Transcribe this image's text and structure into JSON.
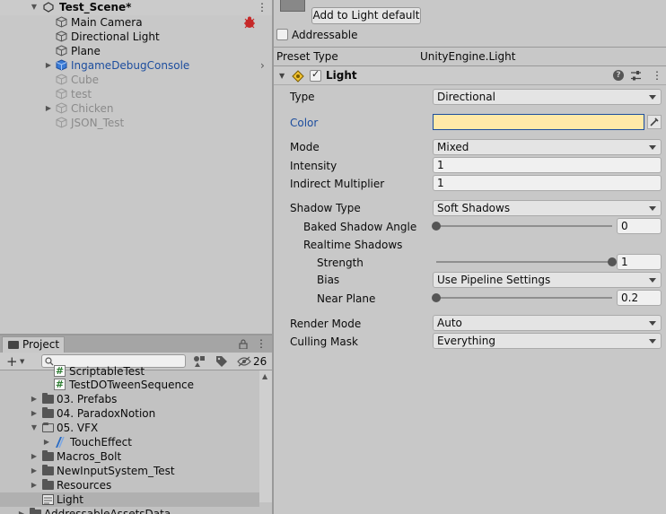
{
  "hierarchy": {
    "scene_name": "Test_Scene*",
    "items": [
      {
        "label": "Main Camera",
        "state": "normal"
      },
      {
        "label": "Directional Light",
        "state": "normal"
      },
      {
        "label": "Plane",
        "state": "normal"
      },
      {
        "label": "IngameDebugConsole",
        "state": "prefab"
      },
      {
        "label": "Cube",
        "state": "disabled"
      },
      {
        "label": "test",
        "state": "disabled"
      },
      {
        "label": "Chicken",
        "state": "disabled"
      },
      {
        "label": "JSON_Test",
        "state": "disabled"
      }
    ]
  },
  "project": {
    "tab_label": "Project",
    "hidden_count": "26",
    "items": [
      {
        "label": "ScriptableTest",
        "kind": "script"
      },
      {
        "label": "TestDOTweenSequence",
        "kind": "script"
      },
      {
        "label": "03. Prefabs",
        "kind": "folder"
      },
      {
        "label": "04. ParadoxNotion",
        "kind": "folder"
      },
      {
        "label": "05. VFX",
        "kind": "folder-open"
      },
      {
        "label": "TouchEffect",
        "kind": "asset"
      },
      {
        "label": "Macros_Bolt",
        "kind": "folder"
      },
      {
        "label": "NewInputSystem_Test",
        "kind": "folder"
      },
      {
        "label": "Resources",
        "kind": "folder"
      },
      {
        "label": "Light",
        "kind": "preset"
      },
      {
        "label": "AddressableAssetsData",
        "kind": "folder"
      }
    ]
  },
  "inspector": {
    "add_default_button": "Add to Light default",
    "addressable_label": "Addressable",
    "preset_type_label": "Preset Type",
    "preset_type_value": "UnityEngine.Light",
    "component_title": "Light",
    "fields": {
      "type": {
        "label": "Type",
        "value": "Directional"
      },
      "color": {
        "label": "Color",
        "swatch": "#ffe9a8"
      },
      "mode": {
        "label": "Mode",
        "value": "Mixed"
      },
      "intensity": {
        "label": "Intensity",
        "value": "1"
      },
      "indirect": {
        "label": "Indirect Multiplier",
        "value": "1"
      },
      "shadow_type": {
        "label": "Shadow Type",
        "value": "Soft Shadows"
      },
      "baked_angle": {
        "label": "Baked Shadow Angle",
        "value": "0",
        "fraction": 0.0
      },
      "realtime_shadows": {
        "label": "Realtime Shadows"
      },
      "strength": {
        "label": "Strength",
        "value": "1",
        "fraction": 1.0
      },
      "bias": {
        "label": "Bias",
        "value": "Use Pipeline Settings"
      },
      "near_plane": {
        "label": "Near Plane",
        "value": "0.2",
        "fraction": 0.0
      },
      "render_mode": {
        "label": "Render Mode",
        "value": "Auto"
      },
      "culling_mask": {
        "label": "Culling Mask",
        "value": "Everything"
      }
    }
  }
}
